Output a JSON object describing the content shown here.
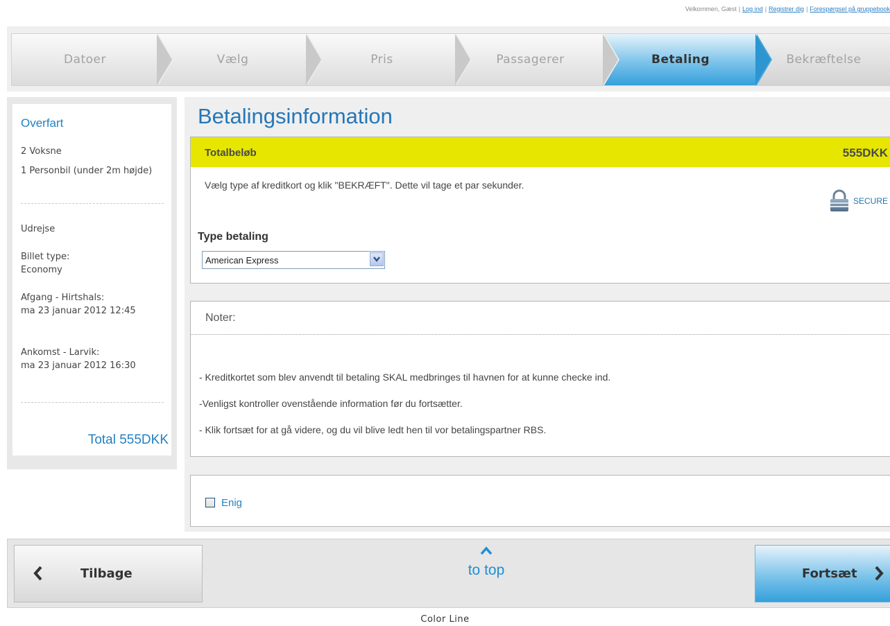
{
  "topbar": {
    "welcome": "Velkommen, Gæst",
    "links": [
      "Log ind",
      "Registrer dig",
      "Forespørgsel på gruppebook"
    ]
  },
  "steps": [
    {
      "label": "Datoer",
      "state": "done"
    },
    {
      "label": "Vælg",
      "state": "done"
    },
    {
      "label": "Pris",
      "state": "done"
    },
    {
      "label": "Passagerer",
      "state": "done"
    },
    {
      "label": "Betaling",
      "state": "active"
    },
    {
      "label": "Bekræftelse",
      "state": "pending"
    }
  ],
  "sidebar": {
    "title": "Overfart",
    "passengers": "2 Voksne",
    "vehicle": "1 Personbil (under 2m højde)",
    "direction": "Udrejse",
    "ticket_label": "Billet type:",
    "ticket_value": "Economy",
    "departure_label": "Afgang - Hirtshals:",
    "departure_value": "ma 23 januar 2012 12:45",
    "arrival_label": "Ankomst - Larvik:",
    "arrival_value": "ma 23 januar 2012 16:30",
    "total": "Total 555DKK"
  },
  "main": {
    "title": "Betalingsinformation",
    "total_label": "Totalbeløb",
    "total_value": "555DKK",
    "instruction": "Vælg type af kreditkort og klik \"BEKRÆFT\". Dette vil tage et par sekunder.",
    "secure_label": "SECURE",
    "payment_label": "Type betaling",
    "payment_selected": "American Express"
  },
  "notes": {
    "title": "Noter:",
    "items": [
      "- Kreditkortet som blev anvendt til betaling SKAL medbringes til havnen for at kunne checke ind.",
      "-Venligst kontroller ovenstående information før du fortsætter.",
      "- Klik fortsæt for at gå videre, og du vil blive ledt hen til vor betalingspartner RBS."
    ]
  },
  "agree": {
    "label": "Enig",
    "checked": false
  },
  "nav": {
    "back": "Tilbage",
    "to_top": "to top",
    "forward": "Fortsæt"
  },
  "footer": "Color Line",
  "colors": {
    "accent": "#2380c2",
    "total_bar": "#e6e600",
    "active_step": "#34a0dc"
  },
  "icons": {
    "secure": "lock-icon",
    "select": "chevron-down-icon",
    "back": "chevron-left-icon",
    "top": "chevron-up-icon",
    "forward": "chevron-right-icon"
  }
}
